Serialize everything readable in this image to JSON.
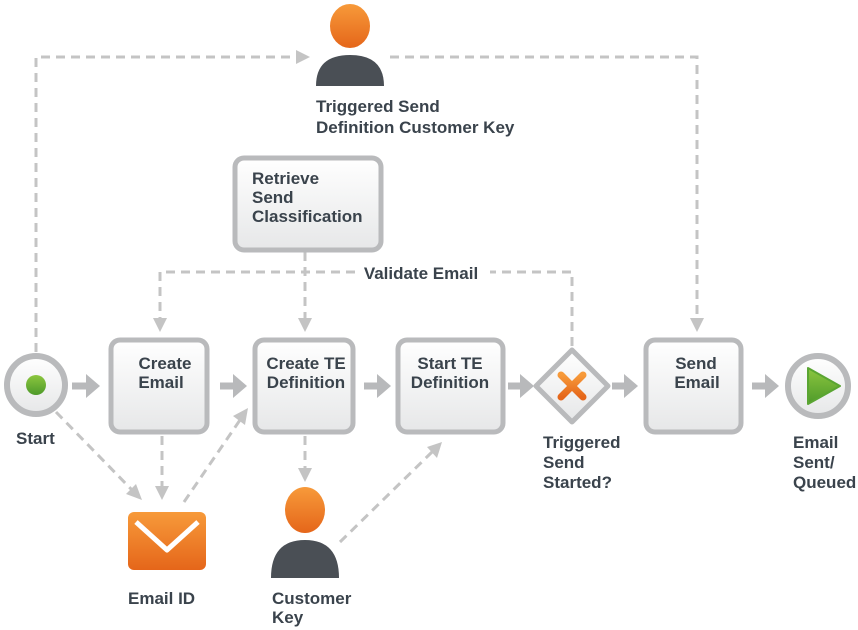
{
  "nodes": {
    "start": {
      "label": "Start"
    },
    "create_email": {
      "label": [
        "Create",
        "Email"
      ]
    },
    "create_te": {
      "label": [
        "Create TE",
        "Definition"
      ]
    },
    "start_te": {
      "label": [
        "Start TE",
        "Definition"
      ]
    },
    "gateway": {
      "label": [
        "Triggered",
        "Send",
        "Started?"
      ]
    },
    "send_email": {
      "label": [
        "Send",
        "Email"
      ]
    },
    "end": {
      "label": [
        "Email",
        "Sent/",
        "Queued"
      ]
    },
    "retrieve": {
      "label": [
        "Retrieve",
        "Send",
        "Classification"
      ]
    },
    "ts_key": {
      "label": [
        "Triggered Send",
        "Definition Customer Key"
      ]
    },
    "email_id": {
      "label": "Email ID"
    },
    "customer_key": {
      "label": [
        "Customer",
        "Key"
      ]
    }
  },
  "edges": {
    "validate_email": "Validate Email"
  },
  "colors": {
    "orange": "#f07d1f",
    "green": "#6db33f",
    "gray": "#b9babc",
    "person_body": "#4a4f55",
    "text": "#3a434c"
  }
}
